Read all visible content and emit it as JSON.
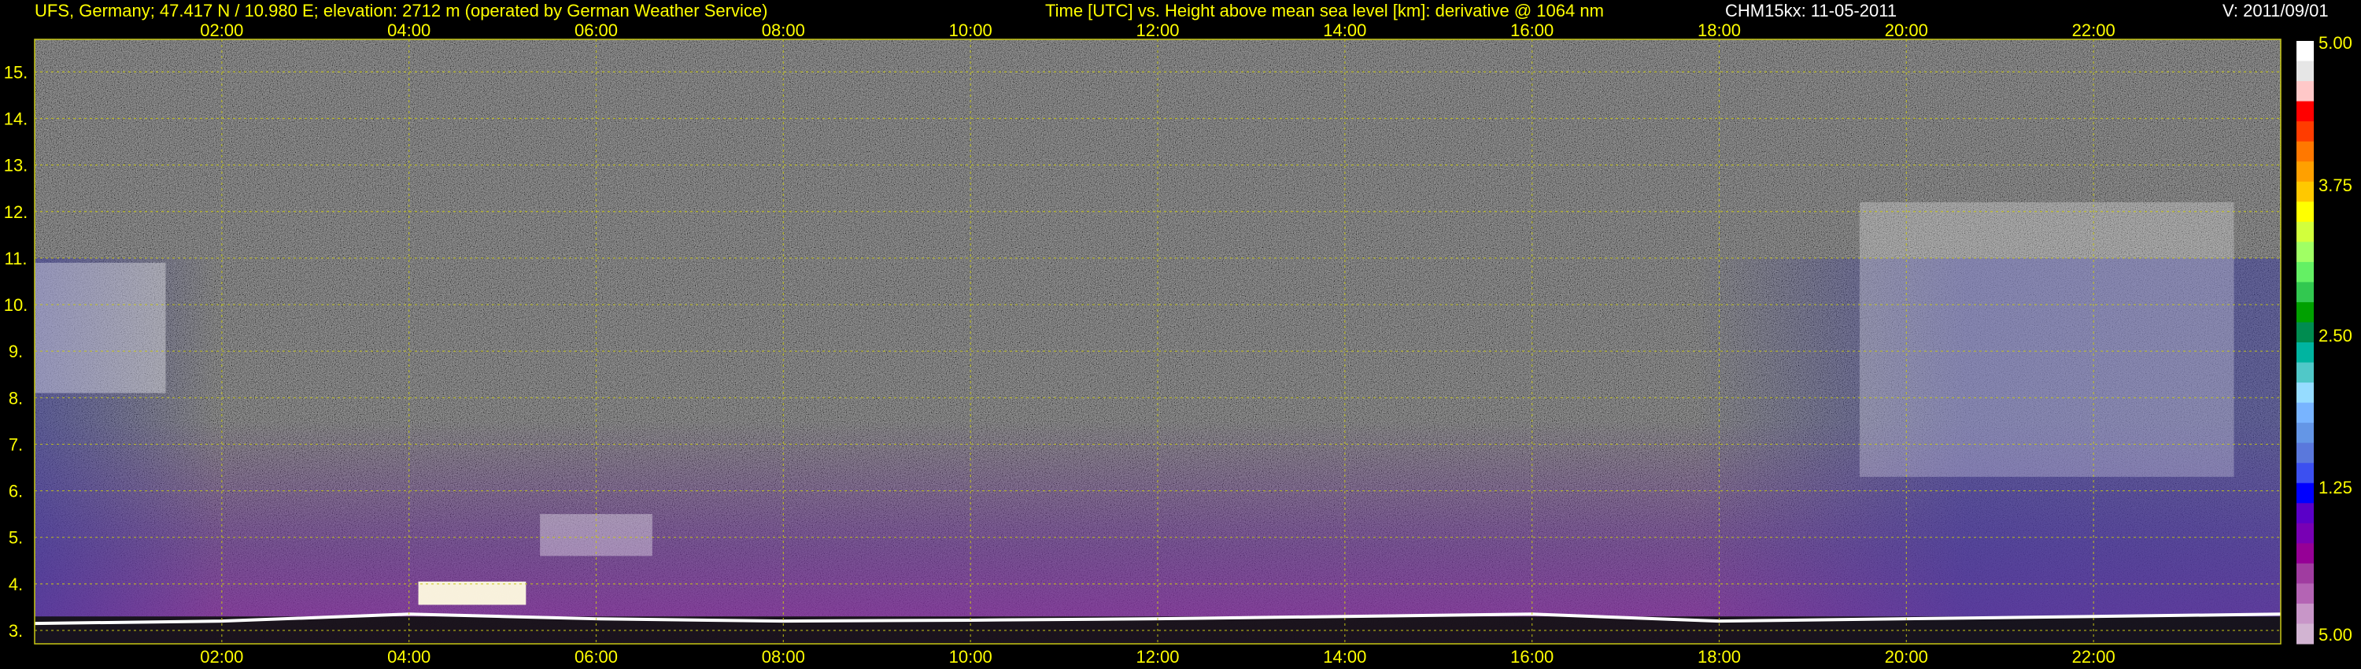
{
  "header": {
    "station": "UFS, Germany; 47.417 N / 10.980 E; elevation: 2712 m  (operated by German Weather Service)",
    "plot_title": "Time [UTC] vs. Height above mean sea level [km]: derivative @ 1064 nm",
    "instrument": "CHM15kx: 11-05-2011",
    "version": "V: 2011/09/01"
  },
  "colors": {
    "axis_text": "#ffff00",
    "grid": "#c8c814",
    "background": "#000000",
    "header_white": "#ffffff"
  },
  "chart_data": {
    "type": "heatmap",
    "title": "Time [UTC] vs. Height above mean sea level [km]: derivative @ 1064 nm",
    "xlabel": "Time [UTC]",
    "ylabel": "Height above mean sea level [km]",
    "x_ticks": [
      "02:00",
      "04:00",
      "06:00",
      "08:00",
      "10:00",
      "12:00",
      "14:00",
      "16:00",
      "18:00",
      "20:00",
      "22:00"
    ],
    "x_tick_hours": [
      2,
      4,
      6,
      8,
      10,
      12,
      14,
      16,
      18,
      20,
      22
    ],
    "xlim_hours": [
      0,
      24
    ],
    "y_ticks": [
      "3.",
      "4.",
      "5.",
      "6.",
      "7.",
      "8.",
      "9.",
      "10.",
      "11.",
      "12.",
      "13.",
      "14.",
      "15."
    ],
    "y_tick_values": [
      3,
      4,
      5,
      6,
      7,
      8,
      9,
      10,
      11,
      12,
      13,
      14,
      15
    ],
    "ylim": [
      2.712,
      15.7
    ],
    "grid": true,
    "colorbar": {
      "labels": [
        "5.00",
        "3.75",
        "2.50",
        "1.25",
        "5.00"
      ],
      "colors": [
        "#ffffff",
        "#e6e6e6",
        "#ffc8c8",
        "#ff0000",
        "#ff3c00",
        "#ff7800",
        "#ffa000",
        "#ffc800",
        "#ffff00",
        "#d2ff3c",
        "#a0ff64",
        "#64f064",
        "#32c850",
        "#00a000",
        "#008c50",
        "#00b4a0",
        "#50c8c8",
        "#96dcff",
        "#78b4ff",
        "#6496e6",
        "#5a78dc",
        "#3c50f0",
        "#0000ff",
        "#5a00c8",
        "#7800b4",
        "#960096",
        "#a03ca0",
        "#b464b4",
        "#c896c8",
        "#d2b4d2"
      ]
    }
  }
}
